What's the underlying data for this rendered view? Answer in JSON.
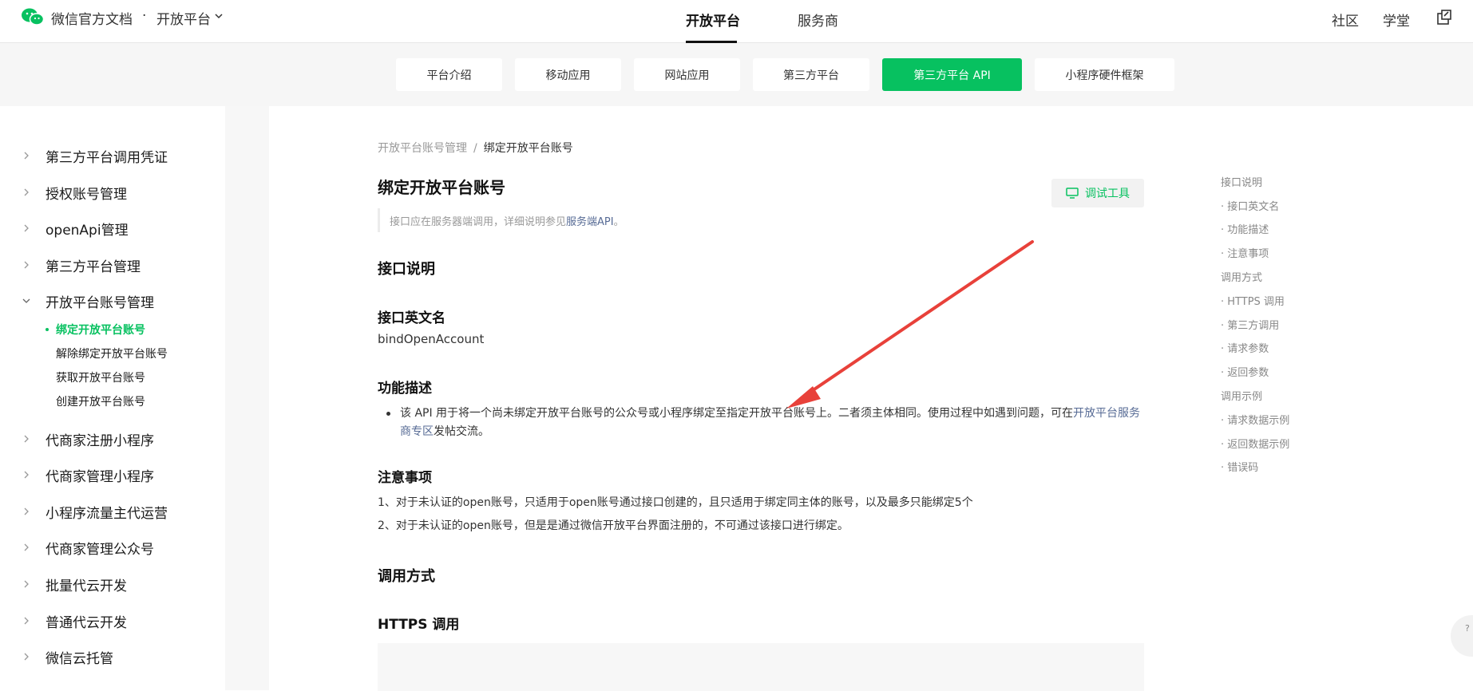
{
  "header": {
    "brand": "微信官方文档",
    "dot": "·",
    "platform": "开放平台",
    "nav": [
      {
        "label": "开放平台"
      },
      {
        "label": "服务商"
      }
    ],
    "right": [
      {
        "label": "社区"
      },
      {
        "label": "学堂"
      }
    ],
    "icon_name": "external-window-icon"
  },
  "subnav": {
    "tabs": [
      {
        "label": "平台介绍"
      },
      {
        "label": "移动应用"
      },
      {
        "label": "网站应用"
      },
      {
        "label": "第三方平台"
      },
      {
        "label": "第三方平台 API"
      },
      {
        "label": "小程序硬件框架"
      }
    ],
    "active_index": 4
  },
  "sidebar": {
    "items": [
      {
        "label": "第三方平台调用凭证"
      },
      {
        "label": "授权账号管理"
      },
      {
        "label": "openApi管理"
      },
      {
        "label": "第三方平台管理"
      },
      {
        "label": "开放平台账号管理"
      },
      {
        "label": "代商家注册小程序"
      },
      {
        "label": "代商家管理小程序"
      },
      {
        "label": "小程序流量主代运营"
      },
      {
        "label": "代商家管理公众号"
      },
      {
        "label": "批量代云开发"
      },
      {
        "label": "普通代云开发"
      },
      {
        "label": "微信云托管"
      }
    ],
    "expanded_index": 4,
    "subitems": [
      {
        "label": "绑定开放平台账号"
      },
      {
        "label": "解除绑定开放平台账号"
      },
      {
        "label": "获取开放平台账号"
      },
      {
        "label": "创建开放平台账号"
      }
    ],
    "active_sub_index": 0
  },
  "content": {
    "breadcrumb": {
      "parent": "开放平台账号管理",
      "sep": "/",
      "current": "绑定开放平台账号"
    },
    "title": "绑定开放平台账号",
    "debug_button": "调试工具",
    "note_prefix": "接口应在服务器端调用，详细说明参见",
    "note_link": "服务端API",
    "note_suffix": "。",
    "h_interface": "接口说明",
    "h_english_name": "接口英文名",
    "english_name": "bindOpenAccount",
    "h_function": "功能描述",
    "func_text": "该 API 用于将一个尚未绑定开放平台账号的公众号或小程序绑定至指定开放平台账号上。二者须主体相同。使用过程中如遇到问题，可在",
    "func_link": "开放平台服务商专区",
    "func_suffix": "发帖交流。",
    "h_notes": "注意事项",
    "notes": [
      "1、对于未认证的open账号，只适用于open账号通过接口创建的，且只适用于绑定同主体的账号，以及最多只能绑定5个",
      "2、对于未认证的open账号，但是是通过微信开放平台界面注册的，不可通过该接口进行绑定。"
    ],
    "h_call": "调用方式",
    "h_https": "HTTPS 调用"
  },
  "toc": {
    "items": [
      {
        "label": "接口说明"
      },
      {
        "label": "· 接口英文名"
      },
      {
        "label": "· 功能描述"
      },
      {
        "label": "· 注意事项"
      },
      {
        "label": "调用方式"
      },
      {
        "label": "· HTTPS 调用"
      },
      {
        "label": "· 第三方调用"
      },
      {
        "label": "· 请求参数"
      },
      {
        "label": "· 返回参数"
      },
      {
        "label": "调用示例"
      },
      {
        "label": "· 请求数据示例"
      },
      {
        "label": "· 返回数据示例"
      },
      {
        "label": "· 错误码"
      }
    ]
  },
  "colors": {
    "accent": "#07c160",
    "link": "#576b95",
    "annotation_arrow": "#e8413a"
  }
}
